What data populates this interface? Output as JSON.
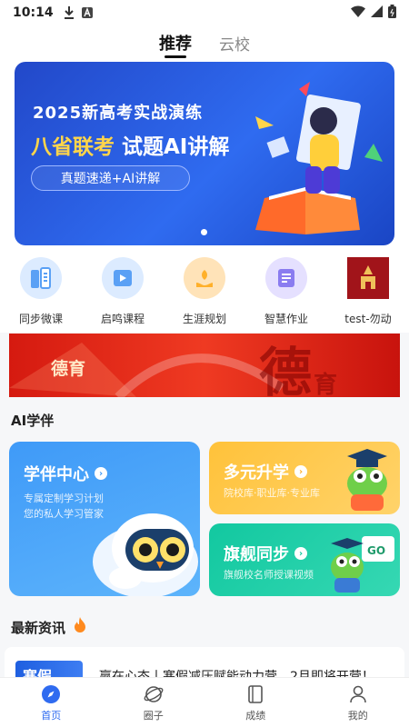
{
  "status_bar": {
    "time": "10:14",
    "download_icon": "download-icon",
    "app_icon": "a-icon",
    "wifi_icon": "wifi-icon",
    "signal_icon": "signal-icon",
    "battery_icon": "battery-icon"
  },
  "top_tabs": [
    {
      "label": "推荐",
      "active": true
    },
    {
      "label": "云校",
      "active": false
    }
  ],
  "banner": {
    "line1": "2025新高考实战演练",
    "line2_highlight": "八省联考",
    "line2_rest": " 试题AI讲解",
    "pill": "真题速递+AI讲解",
    "dots": 1
  },
  "quick_links": [
    {
      "label": "同步微课",
      "icon": "book-stack-icon",
      "color": "#6aa8f6"
    },
    {
      "label": "启鸣课程",
      "icon": "video-icon",
      "color": "#6aa8f6"
    },
    {
      "label": "生涯规划",
      "icon": "plant-hand-icon",
      "color": "#ffb53a"
    },
    {
      "label": "智慧作业",
      "icon": "document-icon",
      "color": "#8a7cf0"
    },
    {
      "label": "test-勿动",
      "icon": "thumbnail-image"
    }
  ],
  "moral_banner": {
    "label": "德育",
    "watermark": "德",
    "watermark2": "育"
  },
  "ai_section": {
    "title": "AI学伴",
    "cards": [
      {
        "title": "学伴中心",
        "sub1": "专属定制学习计划",
        "sub2": "您的私人学习管家"
      },
      {
        "title": "多元升学",
        "sub1": "院校库·职业库·专业库"
      },
      {
        "title": "旗舰同步",
        "sub1": "旗舰校名师授课视频"
      }
    ]
  },
  "news": {
    "title": "最新资讯",
    "items": [
      {
        "thumb": "寒假",
        "text": "赢在心态丨寒假减压赋能动力营，2月即将开营！"
      }
    ]
  },
  "bottom_nav": [
    {
      "label": "首页",
      "icon": "compass-icon",
      "active": true
    },
    {
      "label": "圈子",
      "icon": "planet-icon",
      "active": false
    },
    {
      "label": "成绩",
      "icon": "notebook-icon",
      "active": false
    },
    {
      "label": "我的",
      "icon": "user-icon",
      "active": false
    }
  ],
  "colors": {
    "accent": "#2f6bf0",
    "banner_highlight": "#ffd54a",
    "moral_red": "#e02a18"
  }
}
